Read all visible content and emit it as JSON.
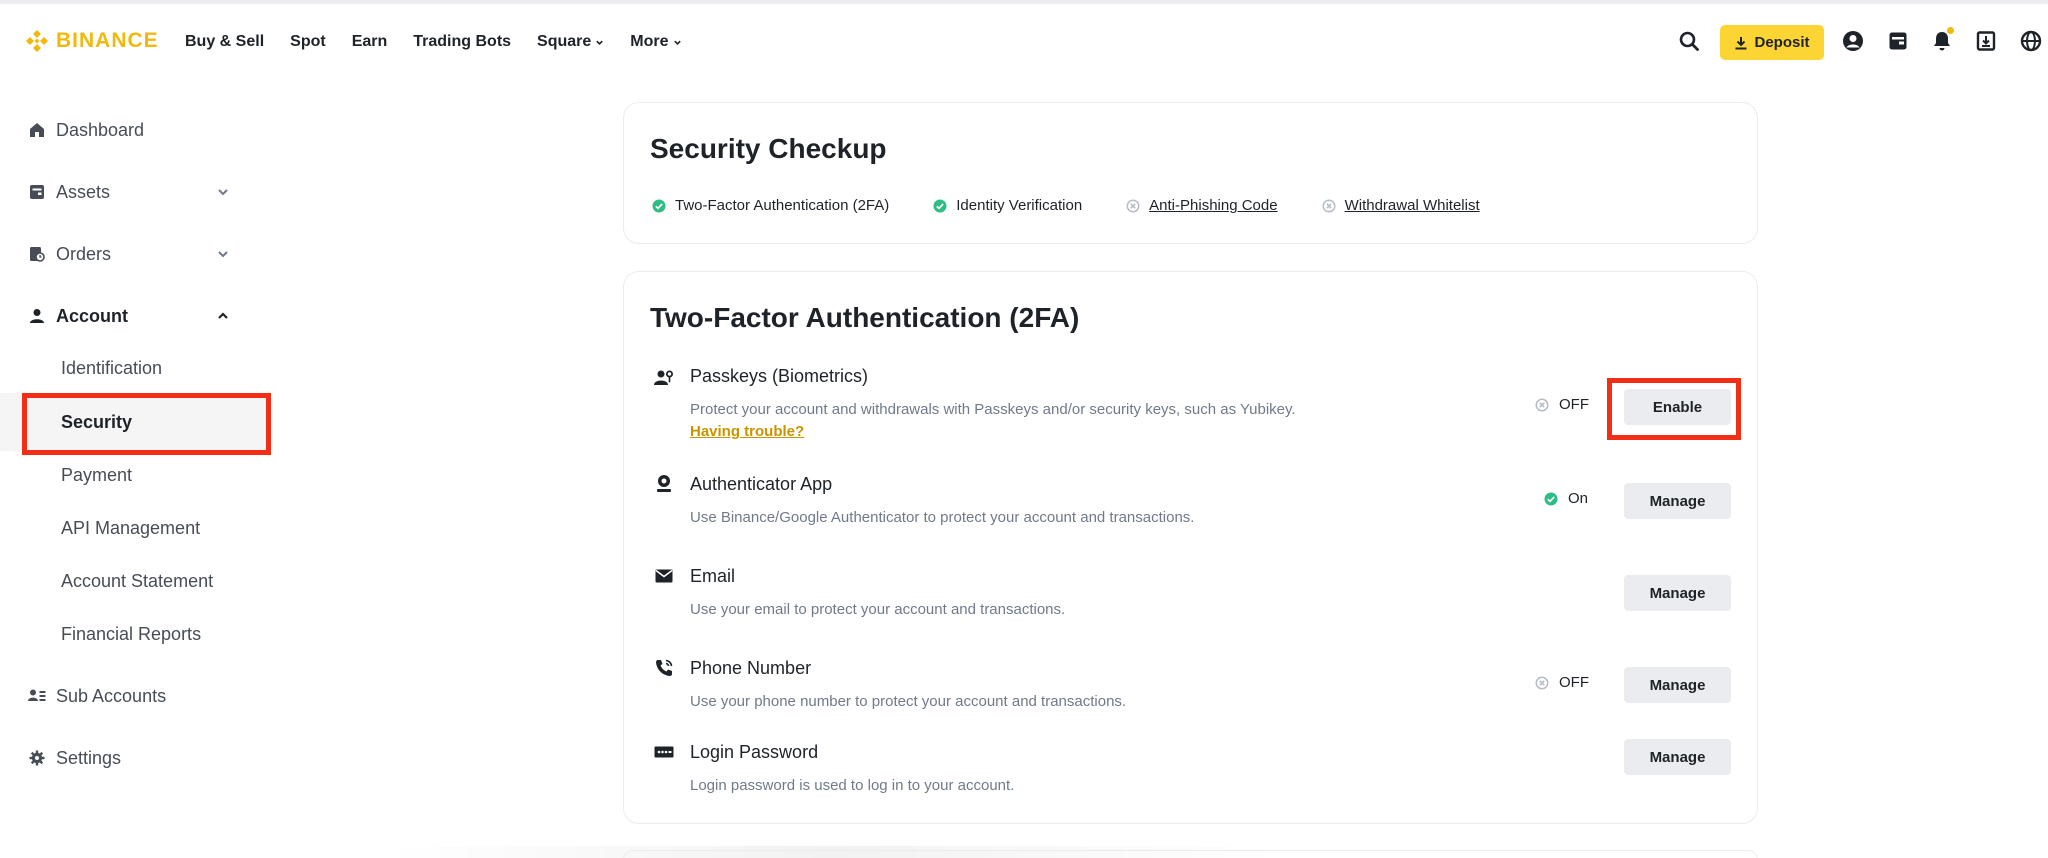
{
  "brand": {
    "name": "BINANCE",
    "color": "#f0b90b"
  },
  "nav": [
    {
      "label": "Buy & Sell",
      "has_menu": false
    },
    {
      "label": "Spot",
      "has_menu": false
    },
    {
      "label": "Earn",
      "has_menu": false
    },
    {
      "label": "Trading Bots",
      "has_menu": false
    },
    {
      "label": "Square",
      "has_menu": true
    },
    {
      "label": "More",
      "has_menu": true
    }
  ],
  "header_actions": {
    "deposit_label": "Deposit",
    "icons": [
      "search-icon",
      "download-icon",
      "profile-icon",
      "wallet-icon",
      "bell-icon",
      "download-app-icon",
      "globe-icon"
    ]
  },
  "sidebar": {
    "items": [
      {
        "label": "Dashboard",
        "icon": "home-icon"
      },
      {
        "label": "Assets",
        "icon": "wallet-icon",
        "expandable": true
      },
      {
        "label": "Orders",
        "icon": "orders-icon",
        "expandable": true
      },
      {
        "label": "Account",
        "icon": "user-icon",
        "expanded": true
      },
      {
        "label": "Sub Accounts",
        "icon": "sub-accounts-icon"
      },
      {
        "label": "Settings",
        "icon": "gear-icon"
      }
    ],
    "account_sub": [
      {
        "label": "Identification"
      },
      {
        "label": "Security",
        "active": true
      },
      {
        "label": "Payment"
      },
      {
        "label": "API Management"
      },
      {
        "label": "Account Statement"
      },
      {
        "label": "Financial Reports"
      }
    ]
  },
  "security_checkup": {
    "title": "Security Checkup",
    "items": [
      {
        "label": "Two-Factor Authentication (2FA)",
        "done": true
      },
      {
        "label": "Identity Verification",
        "done": true
      },
      {
        "label": "Anti-Phishing Code",
        "done": false
      },
      {
        "label": "Withdrawal Whitelist",
        "done": false
      }
    ]
  },
  "twofa": {
    "title": "Two-Factor Authentication (2FA)",
    "rows": [
      {
        "title": "Passkeys (Biometrics)",
        "desc": "Protect your account and withdrawals with Passkeys and/or security keys, such as Yubikey.",
        "link": "Having trouble?",
        "status": "OFF",
        "button": "Enable",
        "icon": "passkeys-icon"
      },
      {
        "title": "Authenticator App",
        "desc": "Use Binance/Google Authenticator to protect your account and transactions.",
        "status": "On",
        "button": "Manage",
        "icon": "authenticator-icon"
      },
      {
        "title": "Email",
        "desc": "Use your email to protect your account and transactions.",
        "status": "",
        "button": "Manage",
        "icon": "email-icon"
      },
      {
        "title": "Phone Number",
        "desc": "Use your phone number to protect your account and transactions.",
        "status": "OFF",
        "button": "Manage",
        "icon": "phone-icon"
      },
      {
        "title": "Login Password",
        "desc": "Login password is used to log in to your account.",
        "status": "",
        "button": "Manage",
        "icon": "password-icon"
      }
    ]
  },
  "colors": {
    "success": "#2ebd85",
    "off": "#b7bdc6",
    "highlight": "#f32e16",
    "button_bg": "#eaecef",
    "deposit_bg": "#fcd535"
  }
}
